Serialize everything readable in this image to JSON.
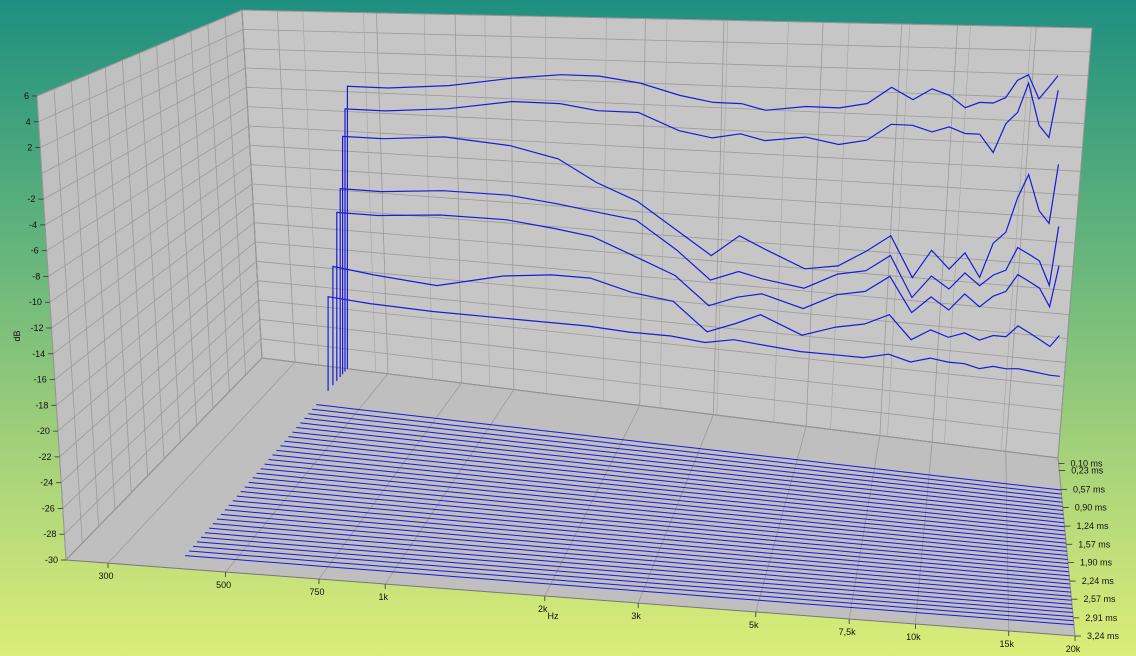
{
  "chart_data": {
    "type": "waterfall-3d-line",
    "title": "",
    "xlabel": "Hz",
    "ylabel": "dB",
    "zlabel": "",
    "x_scale": "log",
    "xlim": [
      250,
      20000
    ],
    "ylim": [
      -30,
      6
    ],
    "x_ticks": [
      {
        "value": 300,
        "label": "300"
      },
      {
        "value": 500,
        "label": "500"
      },
      {
        "value": 750,
        "label": "750"
      },
      {
        "value": 1000,
        "label": "1k"
      },
      {
        "value": 2000,
        "label": "2k"
      },
      {
        "value": 3000,
        "label": "3k"
      },
      {
        "value": 5000,
        "label": "5k"
      },
      {
        "value": 7500,
        "label": "7,5k"
      },
      {
        "value": 10000,
        "label": "10k"
      },
      {
        "value": 15000,
        "label": "15k"
      },
      {
        "value": 20000,
        "label": "20k"
      }
    ],
    "y_ticks": [
      {
        "value": 6,
        "label": "6"
      },
      {
        "value": 4,
        "label": "4"
      },
      {
        "value": 2,
        "label": "2"
      },
      {
        "value": -2,
        "label": "-2"
      },
      {
        "value": -4,
        "label": "-4"
      },
      {
        "value": -6,
        "label": "-6"
      },
      {
        "value": -8,
        "label": "-8"
      },
      {
        "value": -10,
        "label": "-10"
      },
      {
        "value": -12,
        "label": "-12"
      },
      {
        "value": -14,
        "label": "-14"
      },
      {
        "value": -16,
        "label": "-16"
      },
      {
        "value": -18,
        "label": "-18"
      },
      {
        "value": -20,
        "label": "-20"
      },
      {
        "value": -22,
        "label": "-22"
      },
      {
        "value": -24,
        "label": "-24"
      },
      {
        "value": -26,
        "label": "-26"
      },
      {
        "value": -28,
        "label": "-28"
      },
      {
        "value": -30,
        "label": "-30"
      }
    ],
    "time_ticks": [
      {
        "value": 0.1,
        "label": "0,10 ms"
      },
      {
        "value": 0.23,
        "label": "0,23 ms"
      },
      {
        "value": 0.57,
        "label": "0,57 ms"
      },
      {
        "value": 0.9,
        "label": "0,90 ms"
      },
      {
        "value": 1.24,
        "label": "1,24 ms"
      },
      {
        "value": 1.57,
        "label": "1,57 ms"
      },
      {
        "value": 1.9,
        "label": "1,90 ms"
      },
      {
        "value": 2.24,
        "label": "2,24 ms"
      },
      {
        "value": 2.57,
        "label": "2,57 ms"
      },
      {
        "value": 2.91,
        "label": "2,91 ms"
      },
      {
        "value": 3.24,
        "label": "3,24 ms"
      }
    ],
    "tlim": [
      0.0,
      3.24
    ],
    "grid": true,
    "line_color": "#1a1ad8",
    "series": [
      {
        "t": 0.0,
        "x": [
          400,
          500,
          700,
          1000,
          1300,
          1600,
          2000,
          2500,
          3000,
          3500,
          4000,
          5000,
          6000,
          7000,
          8000,
          9000,
          10000,
          11000,
          12000,
          13000,
          14000,
          15000,
          16000,
          17000,
          18000,
          19000,
          20000
        ],
        "y": [
          -1.5,
          -1.5,
          -1.0,
          0.0,
          0.5,
          0.5,
          0.0,
          -1.0,
          -1.5,
          -1.5,
          -2.0,
          -1.5,
          -1.5,
          -1.0,
          0.5,
          -0.5,
          0.5,
          0.0,
          -1.0,
          -0.5,
          -0.5,
          0.0,
          1.5,
          2.0,
          0.0,
          1.0,
          2.0
        ]
      },
      {
        "t": 0.05,
        "x": [
          400,
          500,
          700,
          1000,
          1300,
          1600,
          2000,
          2500,
          3000,
          3500,
          4000,
          5000,
          6000,
          7000,
          8000,
          9000,
          10000,
          11000,
          12000,
          13000,
          14000,
          15000,
          16000,
          17000,
          18000,
          19000,
          20000
        ],
        "y": [
          -3.5,
          -3.5,
          -3.0,
          -2.0,
          -2.0,
          -2.5,
          -2.5,
          -4.0,
          -4.5,
          -4.0,
          -4.5,
          -4.0,
          -4.5,
          -4.0,
          -2.5,
          -2.5,
          -3.0,
          -2.5,
          -3.0,
          -3.0,
          -4.5,
          -2.0,
          -1.0,
          1.5,
          -2.0,
          -3.0,
          1.0
        ]
      },
      {
        "t": 0.1,
        "x": [
          400,
          500,
          700,
          1000,
          1300,
          1600,
          2000,
          2500,
          3000,
          3500,
          4000,
          5000,
          6000,
          7000,
          8000,
          9000,
          10000,
          11000,
          12000,
          13000,
          14000,
          15000,
          16000,
          17000,
          18000,
          19000,
          20000
        ],
        "y": [
          -6.0,
          -6.0,
          -5.5,
          -6.0,
          -7.0,
          -9.0,
          -10.5,
          -13.0,
          -15.0,
          -13.0,
          -14.0,
          -15.5,
          -15.0,
          -13.5,
          -12.0,
          -15.5,
          -13.0,
          -14.5,
          -13.0,
          -15.0,
          -12.0,
          -11.0,
          -8.0,
          -6.0,
          -9.0,
          -10.0,
          -5.0
        ]
      },
      {
        "t": 0.15,
        "x": [
          400,
          500,
          700,
          1000,
          1300,
          1600,
          2000,
          2500,
          3000,
          3500,
          4000,
          5000,
          6000,
          7000,
          8000,
          9000,
          10000,
          11000,
          12000,
          13000,
          14000,
          15000,
          16000,
          17000,
          18000,
          19000,
          20000
        ],
        "y": [
          -11.0,
          -11.0,
          -10.5,
          -10.5,
          -11.0,
          -11.5,
          -12.0,
          -14.5,
          -17.0,
          -16.0,
          -16.5,
          -17.0,
          -15.5,
          -15.0,
          -13.5,
          -17.0,
          -15.0,
          -16.0,
          -14.5,
          -15.5,
          -14.5,
          -14.0,
          -12.0,
          -12.5,
          -13.0,
          -15.0,
          -10.0
        ]
      },
      {
        "t": 0.22,
        "x": [
          400,
          500,
          700,
          1000,
          1300,
          1600,
          2000,
          2500,
          3000,
          3500,
          4000,
          5000,
          6000,
          7000,
          8000,
          9000,
          10000,
          11000,
          12000,
          13000,
          14000,
          15000,
          16000,
          17000,
          18000,
          19000,
          20000
        ],
        "y": [
          -13.0,
          -13.0,
          -12.5,
          -12.5,
          -13.0,
          -13.5,
          -15.0,
          -16.5,
          -19.0,
          -18.0,
          -17.5,
          -18.5,
          -17.0,
          -16.5,
          -15.0,
          -18.0,
          -16.5,
          -17.5,
          -16.0,
          -17.0,
          -16.0,
          -15.5,
          -14.0,
          -14.5,
          -15.0,
          -16.5,
          -13.0
        ]
      },
      {
        "t": 0.3,
        "x": [
          400,
          500,
          700,
          1000,
          1300,
          1600,
          2000,
          2500,
          3000,
          3500,
          4000,
          5000,
          6000,
          7000,
          8000,
          9000,
          10000,
          11000,
          12000,
          13000,
          14000,
          15000,
          16000,
          17000,
          18000,
          19000,
          20000
        ],
        "y": [
          -18.0,
          -18.5,
          -19.0,
          -17.5,
          -17.0,
          -17.0,
          -18.0,
          -18.5,
          -21.0,
          -20.0,
          -19.0,
          -20.5,
          -19.5,
          -19.0,
          -18.0,
          -20.0,
          -19.0,
          -19.5,
          -19.0,
          -19.5,
          -19.0,
          -19.0,
          -18.0,
          -18.5,
          -19.0,
          -19.5,
          -18.5
        ]
      },
      {
        "t": 0.4,
        "x": [
          400,
          500,
          700,
          1000,
          1300,
          1600,
          2000,
          2500,
          3000,
          3500,
          4000,
          5000,
          6000,
          7000,
          8000,
          9000,
          10000,
          11000,
          12000,
          13000,
          14000,
          15000,
          16000,
          17000,
          18000,
          19000,
          20000
        ],
        "y": [
          -20.5,
          -20.8,
          -21.0,
          -21.0,
          -21.0,
          -21.0,
          -21.2,
          -21.2,
          -21.5,
          -21.0,
          -21.2,
          -21.5,
          -21.5,
          -21.5,
          -21.0,
          -21.5,
          -21.0,
          -21.2,
          -21.2,
          -21.5,
          -21.2,
          -21.3,
          -21.2,
          -21.3,
          -21.4,
          -21.5,
          -21.5
        ]
      }
    ],
    "decay_floor_db": -30
  }
}
